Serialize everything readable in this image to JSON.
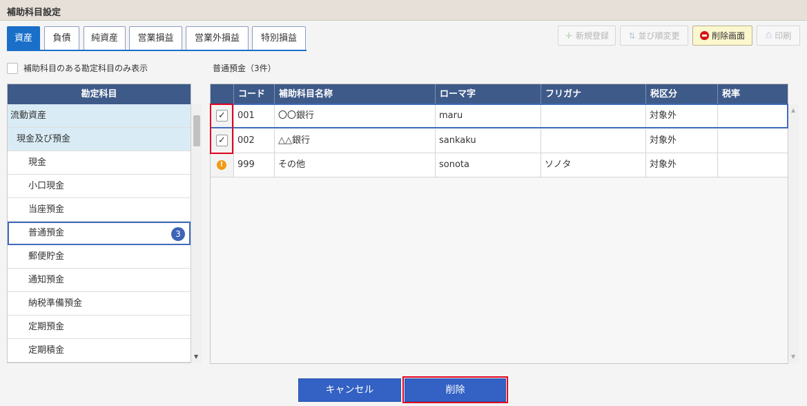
{
  "window": {
    "title": "補助科目設定"
  },
  "tabs": [
    {
      "label": "資産",
      "active": true
    },
    {
      "label": "負債",
      "active": false
    },
    {
      "label": "純資産",
      "active": false
    },
    {
      "label": "営業損益",
      "active": false
    },
    {
      "label": "営業外損益",
      "active": false
    },
    {
      "label": "特別損益",
      "active": false
    }
  ],
  "toolbar": {
    "new_label": "新規登録",
    "sort_label": "並び順変更",
    "delete_screen_label": "削除画面",
    "print_label": "印刷"
  },
  "filter": {
    "label": "補助科目のある勘定科目のみ表示",
    "checked": false
  },
  "left": {
    "header": "勘定科目",
    "items": [
      {
        "label": "流動資産",
        "kind": "category"
      },
      {
        "label": "現金及び預金",
        "kind": "category"
      },
      {
        "label": "現金",
        "kind": "account"
      },
      {
        "label": "小口現金",
        "kind": "account"
      },
      {
        "label": "当座預金",
        "kind": "account"
      },
      {
        "label": "普通預金",
        "kind": "account",
        "selected": true,
        "badge": "3"
      },
      {
        "label": "郵便貯金",
        "kind": "account"
      },
      {
        "label": "通知預金",
        "kind": "account"
      },
      {
        "label": "納税準備預金",
        "kind": "account"
      },
      {
        "label": "定期預金",
        "kind": "account"
      },
      {
        "label": "定期積金",
        "kind": "account"
      }
    ]
  },
  "right": {
    "title": "普通預金（3件）",
    "columns": [
      "コード",
      "補助科目名称",
      "ローマ字",
      "フリガナ",
      "税区分",
      "税率"
    ],
    "rows": [
      {
        "mark": "check",
        "code": "001",
        "name": "〇〇銀行",
        "romaji": "maru",
        "furigana": "",
        "tax": "対象外",
        "rate": ""
      },
      {
        "mark": "check",
        "code": "002",
        "name": "△△銀行",
        "romaji": "sankaku",
        "furigana": "",
        "tax": "対象外",
        "rate": ""
      },
      {
        "mark": "warning",
        "code": "999",
        "name": "その他",
        "romaji": "sonota",
        "furigana": "ソノタ",
        "tax": "対象外",
        "rate": ""
      }
    ]
  },
  "footer": {
    "cancel_label": "キャンセル",
    "delete_label": "削除"
  },
  "colors": {
    "accent": "#1a6fc9",
    "header": "#3e5a89",
    "highlight": "#e1001e",
    "warning": "#f29a14"
  }
}
